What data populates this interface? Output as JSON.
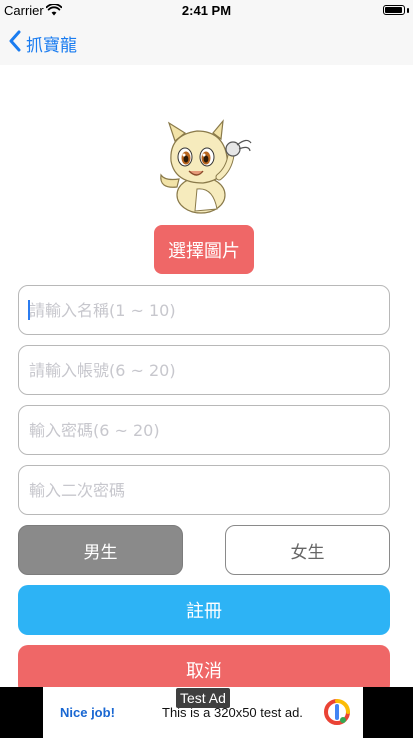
{
  "status_bar": {
    "carrier": "Carrier",
    "time": "2:41 PM",
    "battery_level": 1.0
  },
  "nav": {
    "back_label": "抓寶龍"
  },
  "form": {
    "choose_image_label": "選擇圖片",
    "name_placeholder": "請輸入名稱(1 ~ 10)",
    "account_placeholder": "請輸入帳號(6 ~ 20)",
    "password_placeholder": "輸入密碼(6 ~ 20)",
    "confirm_password_placeholder": "輸入二次密碼",
    "gender_male": "男生",
    "gender_female": "女生",
    "register_label": "註冊",
    "cancel_label": "取消"
  },
  "ad": {
    "label": "Test Ad",
    "nice_job": "Nice job!",
    "message": "This is a 320x50 test ad."
  },
  "colors": {
    "accent_blue": "#2db3f5",
    "accent_red": "#ef6767",
    "selected_gray": "#8a8a8a",
    "nav_tint": "#1a7cf0"
  }
}
